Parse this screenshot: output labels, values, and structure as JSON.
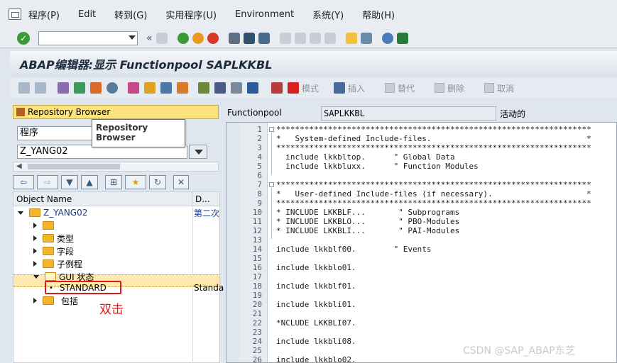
{
  "menu": [
    "程序(P)",
    "Edit",
    "转到(G)",
    "实用程序(U)",
    "Environment",
    "系统(Y)",
    "帮助(H)"
  ],
  "toolbar": {
    "command_value": "",
    "nav_glyph": "«"
  },
  "title": "ABAP编辑器:显示 Functionpool SAPLKKBL",
  "app_toolbar": {
    "mode": "模式",
    "insert": "插入",
    "replace": "替代",
    "delete": "删除",
    "cancel": "取消"
  },
  "left": {
    "panel_title": "Repository Browser",
    "type_value": "程序",
    "name_value": "Z_YANG02",
    "tooltip": "Repository Browser",
    "columns": [
      "Object Name",
      "D..."
    ],
    "tree": [
      {
        "label": "Z_YANG02",
        "desc": "第二次"
      },
      {
        "label": "",
        "desc": ""
      },
      {
        "label": "类型",
        "desc": ""
      },
      {
        "label": "字段",
        "desc": ""
      },
      {
        "label": "子例程",
        "desc": ""
      },
      {
        "label": "GUI 状态",
        "desc": ""
      },
      {
        "label": "STANDARD",
        "desc": "Standa"
      },
      {
        "label": "包括",
        "desc": ""
      }
    ],
    "annotation": "双击"
  },
  "right": {
    "field_label": "Functionpool",
    "field_value": "SAPLKKBL",
    "status": "活动的",
    "lines": [
      {
        "n": "1",
        "t": "*******************************************************************"
      },
      {
        "n": "2",
        "t": "*   System-defined Include-files.                                 *"
      },
      {
        "n": "3",
        "t": "*******************************************************************"
      },
      {
        "n": "4",
        "t": "  include lkkbltop.      \" Global Data"
      },
      {
        "n": "5",
        "t": "  include lkkbluxx.      \" Function Modules"
      },
      {
        "n": "6",
        "t": ""
      },
      {
        "n": "7",
        "t": "*******************************************************************"
      },
      {
        "n": "8",
        "t": "*   User-defined Include-files (if necessary).                    *"
      },
      {
        "n": "9",
        "t": "*******************************************************************"
      },
      {
        "n": "10",
        "t": "* INCLUDE LKKBLF...       \" Subprograms"
      },
      {
        "n": "11",
        "t": "* INCLUDE LKKBLO...       \" PBO-Modules"
      },
      {
        "n": "12",
        "t": "* INCLUDE LKKBLI...       \" PAI-Modules"
      },
      {
        "n": "13",
        "t": ""
      },
      {
        "n": "14",
        "t": "include lkkblf00.        \" Events"
      },
      {
        "n": "15",
        "t": ""
      },
      {
        "n": "16",
        "t": "include lkkblo01."
      },
      {
        "n": "17",
        "t": ""
      },
      {
        "n": "18",
        "t": "include lkkblf01."
      },
      {
        "n": "19",
        "t": ""
      },
      {
        "n": "20",
        "t": "include lkkbli01."
      },
      {
        "n": "21",
        "t": ""
      },
      {
        "n": "22",
        "t": "*NCLUDE LKKBLI07."
      },
      {
        "n": "23",
        "t": ""
      },
      {
        "n": "24",
        "t": "include lkkbli08."
      },
      {
        "n": "25",
        "t": ""
      },
      {
        "n": "26",
        "t": "include lkkblo02."
      }
    ]
  },
  "watermark": "CSDN @SAP_ABAP东芝",
  "colors": {
    "accent_yellow": "#fbe47d",
    "highlight_red": "#e01818",
    "folder": "#f2b52c"
  }
}
